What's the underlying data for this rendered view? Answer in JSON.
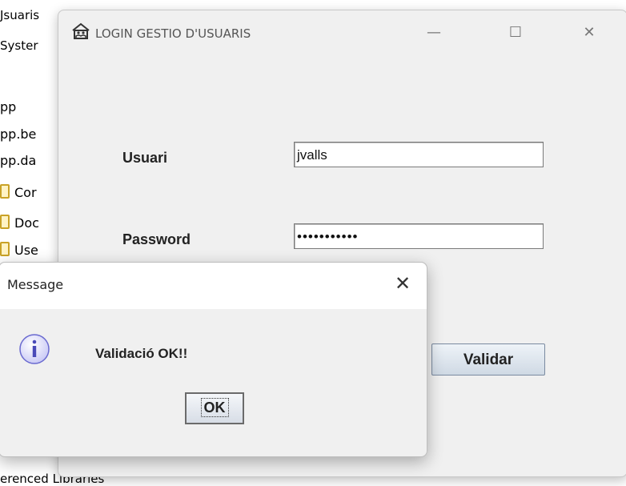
{
  "background_tree": [
    {
      "text": "Jsuaris"
    },
    {
      "text": "Syster"
    },
    {
      "text": "pp"
    },
    {
      "text": "pp.be"
    },
    {
      "text": "pp.da"
    },
    {
      "text": "Cor"
    },
    {
      "text": "Doc"
    },
    {
      "text": "Use"
    },
    {
      "text": "erenced Libraries"
    }
  ],
  "window": {
    "title": "LOGIN GESTIO D'USUARIS",
    "minimize": "—",
    "maximize": "☐",
    "close": "✕"
  },
  "form": {
    "user_label": "Usuari",
    "user_value": "jvalls",
    "password_label": "Password",
    "password_value": "•••••••••••",
    "validate_button": "Validar"
  },
  "dialog": {
    "title": "Message",
    "close": "✕",
    "message": "Validació OK!!",
    "ok_button": "OK",
    "icon": "info-icon"
  }
}
